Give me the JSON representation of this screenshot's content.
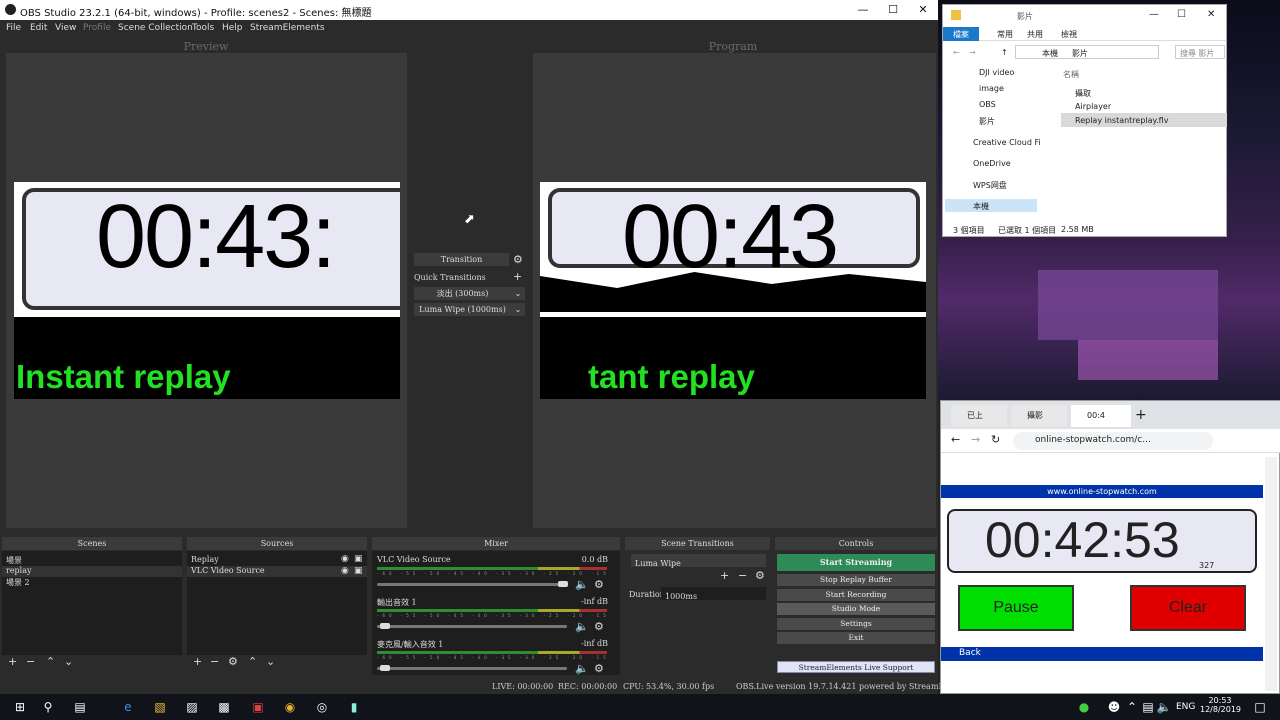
{
  "obs": {
    "title": "OBS Studio 23.2.1 (64-bit, windows) - Profile: scenes2 - Scenes: 無標題",
    "menu": [
      "File",
      "Edit",
      "View",
      "Profile",
      "Scene Collection",
      "Tools",
      "Help",
      "StreamElements"
    ],
    "preview_label": "Preview",
    "program_label": "Program",
    "preview": {
      "time": "00:43:",
      "caption": "Instant replay"
    },
    "program": {
      "time": "00:43",
      "caption": "tant replay"
    },
    "transition": {
      "button": "Transition",
      "quick_label": "Quick Transitions",
      "quick_items": [
        "淡出 (300ms)",
        "Luma Wipe (1000ms)"
      ]
    },
    "docks": {
      "scenes": {
        "title": "Scenes",
        "items": [
          "場景",
          "replay",
          "場景 2"
        ]
      },
      "sources": {
        "title": "Sources",
        "items": [
          "Replay",
          "VLC Video Source"
        ]
      },
      "mixer": {
        "title": "Mixer",
        "channels": [
          {
            "name": "VLC Video Source",
            "db": "0.0 dB"
          },
          {
            "name": "輸出音效 1",
            "db": "-inf dB"
          },
          {
            "name": "麥克風/輸入音效 1",
            "db": "-inf dB"
          }
        ],
        "ticks": "-60 -55 -50 -45 -40 -35 -30 -25 -20 -15 -10 -5 0"
      },
      "scene_transitions": {
        "title": "Scene Transitions",
        "selected": "Luma Wipe",
        "duration_label": "Duration",
        "duration_value": "1000ms"
      },
      "controls": {
        "title": "Controls",
        "buttons": [
          "Start Streaming",
          "Stop Replay Buffer",
          "Start Recording",
          "Studio Mode",
          "Settings",
          "Exit"
        ],
        "support": "StreamElements Live Support"
      }
    },
    "status": {
      "live": "LIVE: 00:00:00",
      "rec": "REC: 00:00:00",
      "cpu": "CPU: 53.4%, 30.00 fps",
      "version": "OBS.Live version 19.7.14.421 powered by StreamElements"
    }
  },
  "explorer": {
    "title": "影片",
    "ribbon": [
      "檔案",
      "常用",
      "共用",
      "檢視"
    ],
    "path": [
      "本機",
      "影片"
    ],
    "search_placeholder": "搜尋 影片",
    "nav": [
      "DJI video",
      "image",
      "OBS",
      "影片",
      "Creative Cloud Fi",
      "OneDrive",
      "WPS网盘",
      "本機"
    ],
    "column": "名稱",
    "files": [
      "攝取",
      "Airplayer",
      "Replay instantreplay.flv"
    ],
    "status": {
      "count": "3 個項目",
      "selected": "已選取 1 個項目",
      "size": "2.58 MB"
    }
  },
  "chrome": {
    "tabs": [
      "已上",
      "攝影",
      "00:4"
    ],
    "url": "online-stopwatch.com/c...",
    "site_header": "www.online-stopwatch.com",
    "time": "00:42:53",
    "ms": "327",
    "pause": "Pause",
    "clear": "Clear",
    "back": "Back"
  },
  "taskbar": {
    "lang": "ENG",
    "time": "20:53",
    "date": "12/8/2019"
  },
  "colors": {
    "obs_bg": "#2b2b2b",
    "start_streaming": "#2e8b57",
    "pause": "#00e000",
    "clear": "#e00000",
    "site_bar": "#0033aa",
    "caption_green": "#22e022"
  }
}
